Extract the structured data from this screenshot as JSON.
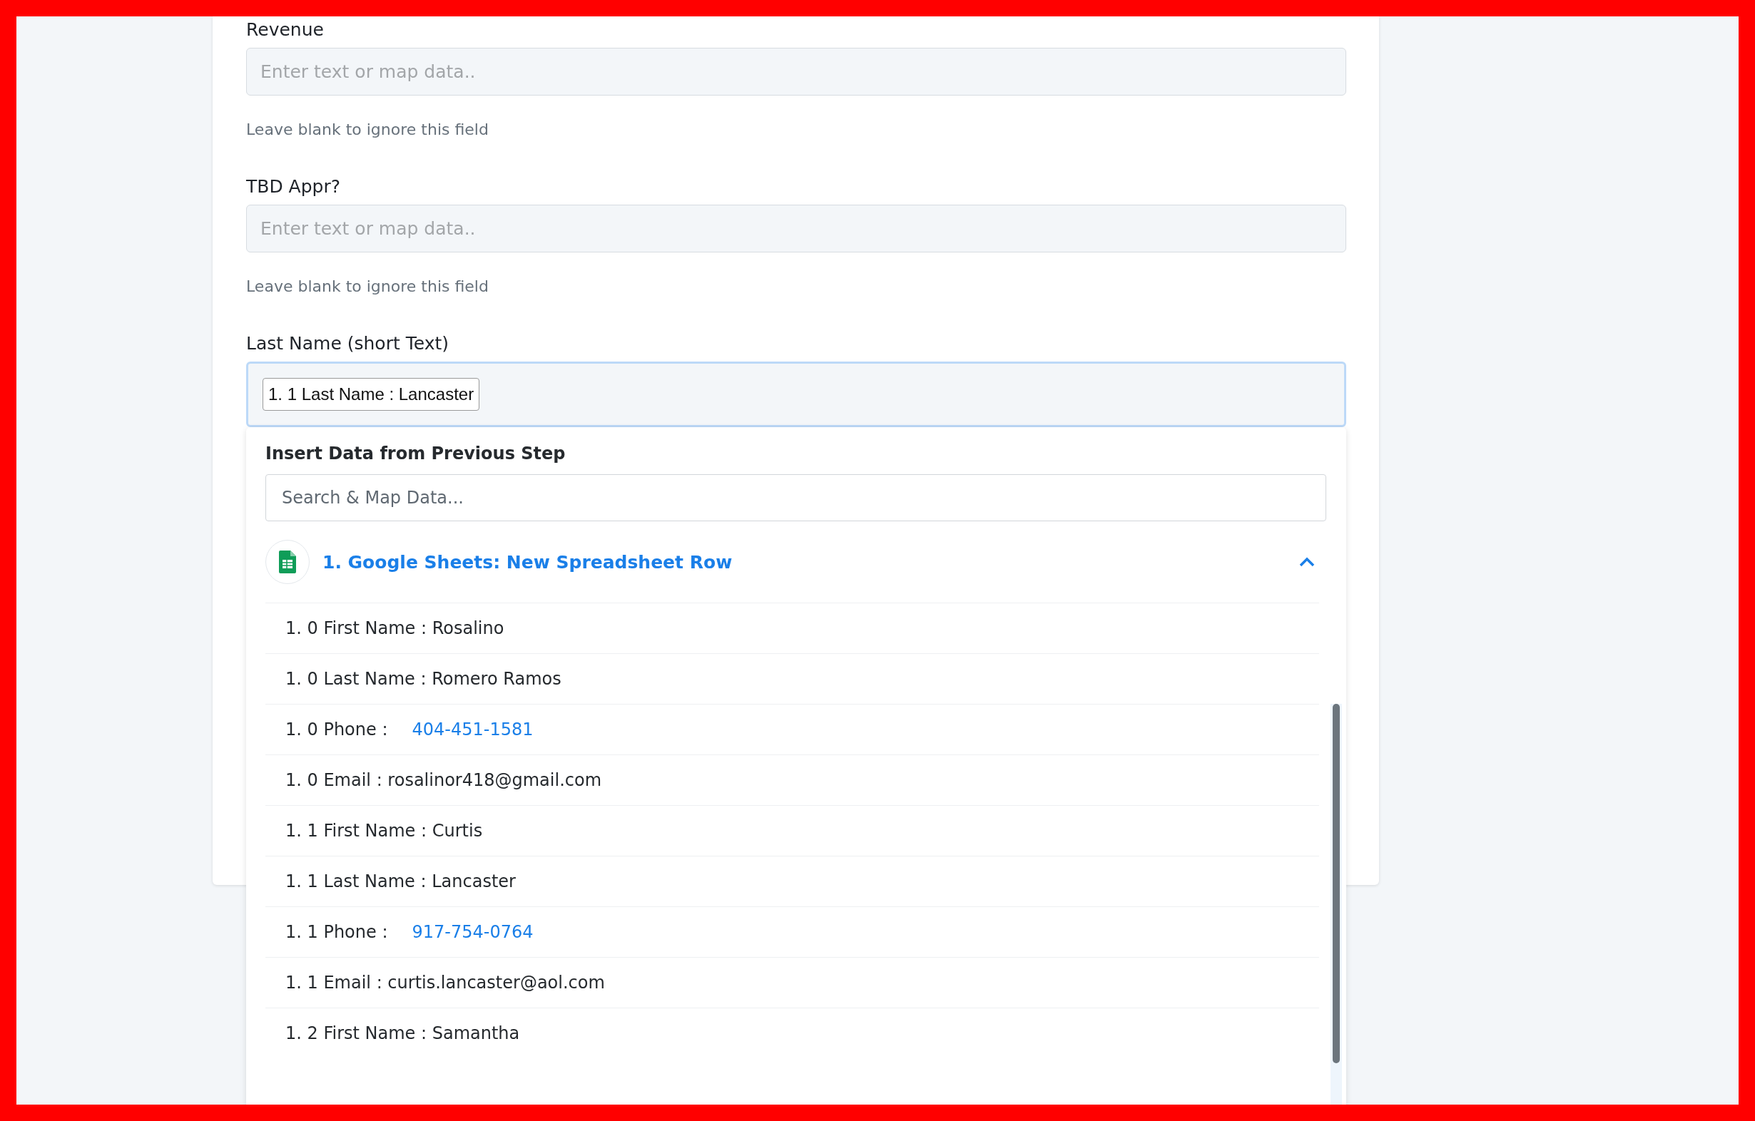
{
  "fields": [
    {
      "label": "Revenue",
      "placeholder": "Enter text or map data..",
      "help": "Leave blank to ignore this field",
      "focused": false
    },
    {
      "label": "TBD Appr?",
      "placeholder": "Enter text or map data..",
      "help": "Leave blank to ignore this field",
      "focused": false
    },
    {
      "label": "Last Name (short Text)",
      "token": "1. 1 Last Name : Lancaster",
      "focused": true
    }
  ],
  "dropdown": {
    "title": "Insert Data from Previous Step",
    "search": {
      "placeholder": "Search & Map Data..."
    },
    "groups": [
      {
        "title": "1. Google Sheets: New Spreadsheet Row",
        "expanded": true,
        "items": [
          {
            "kind": "text",
            "text": "1. 0 First Name : Rosalino"
          },
          {
            "kind": "text",
            "text": "1. 0 Last Name : Romero Ramos"
          },
          {
            "kind": "phone",
            "label": "1. 0 Phone :",
            "value": "404-451-1581"
          },
          {
            "kind": "text",
            "text": "1. 0 Email : rosalinor418@gmail.com"
          },
          {
            "kind": "text",
            "text": "1. 1 First Name : Curtis"
          },
          {
            "kind": "text",
            "text": "1. 1 Last Name : Lancaster"
          },
          {
            "kind": "phone",
            "label": "1. 1 Phone :",
            "value": "917-754-0764"
          },
          {
            "kind": "text",
            "text": "1. 1 Email : curtis.lancaster@aol.com"
          },
          {
            "kind": "text",
            "text": "1. 2 First Name : Samantha"
          }
        ]
      }
    ]
  }
}
